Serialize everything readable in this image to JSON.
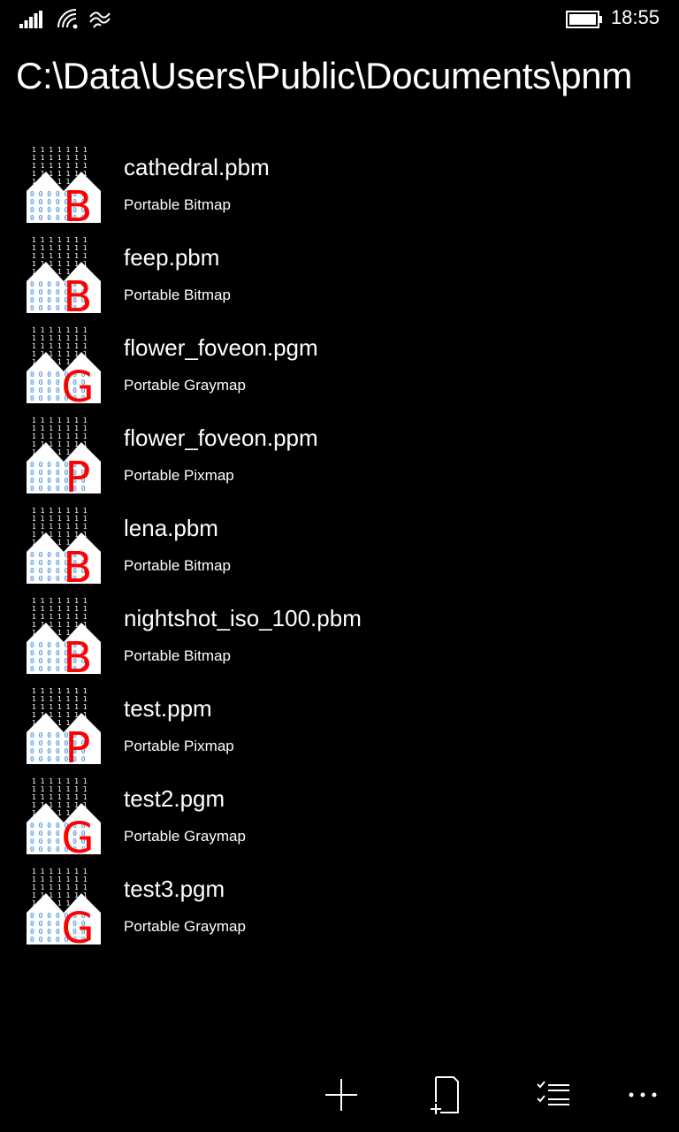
{
  "status_bar": {
    "time": "18:55",
    "icons": [
      "signal-strength-icon",
      "wifi-icon",
      "data-sense-icon",
      "battery-icon"
    ]
  },
  "header": {
    "path": "C:\\Data\\Users\\Public\\Documents\\pnm"
  },
  "files": [
    {
      "name": "cathedral.pbm",
      "type": "Portable Bitmap",
      "badge": "B"
    },
    {
      "name": "feep.pbm",
      "type": "Portable Bitmap",
      "badge": "B"
    },
    {
      "name": "flower_foveon.pgm",
      "type": "Portable Graymap",
      "badge": "G"
    },
    {
      "name": "flower_foveon.ppm",
      "type": "Portable Pixmap",
      "badge": "P"
    },
    {
      "name": "lena.pbm",
      "type": "Portable Bitmap",
      "badge": "B"
    },
    {
      "name": "nightshot_iso_100.pbm",
      "type": "Portable Bitmap",
      "badge": "B"
    },
    {
      "name": "test.ppm",
      "type": "Portable Pixmap",
      "badge": "P"
    },
    {
      "name": "test2.pgm",
      "type": "Portable Graymap",
      "badge": "G"
    },
    {
      "name": "test3.pgm",
      "type": "Portable Graymap",
      "badge": "G"
    }
  ],
  "app_bar": {
    "buttons": [
      "add-icon",
      "new-file-icon",
      "select-list-icon",
      "more-icon"
    ]
  },
  "colors": {
    "background": "#000000",
    "text": "#ffffff",
    "badge": "#ff0000",
    "thumb_digits_top": "#ffffff",
    "thumb_digits_bottom": "#2a7fd4"
  }
}
